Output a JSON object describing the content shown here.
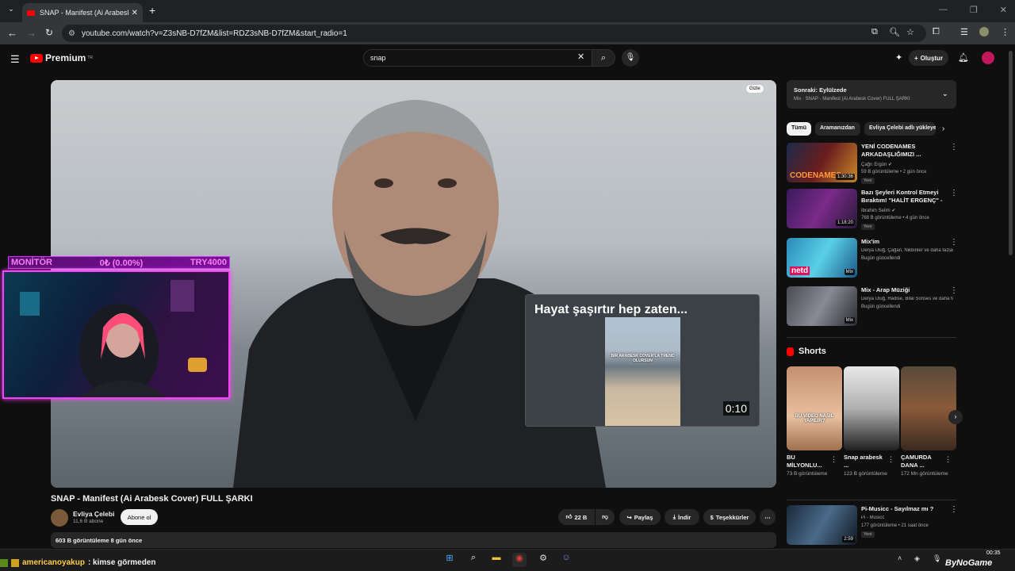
{
  "browser": {
    "tab_title": "SNAP - Manifest (Ai Arabesk Co",
    "new_tab": "+",
    "url": "youtube.com/watch?v=Z3sNB-D7fZM&list=RDZ3sNB-D7fZM&start_radio=1"
  },
  "youtube": {
    "logo": "Premium",
    "region": "TR",
    "search_value": "snap",
    "create_label": "Oluştur"
  },
  "video": {
    "hide_label": "Gizle",
    "preview_title": "Hayat şaşırtır hep zaten...",
    "preview_caption": "BİR ARABESK COVER'LA TREND OLURSUN",
    "preview_duration": "0:10",
    "title": "SNAP - Manifest (Ai Arabesk Cover) FULL ŞARKI",
    "channel": "Evliya Çelebi",
    "subscribers": "11,6 B abone",
    "subscribe": "Abone ol",
    "likes": "22 B",
    "share": "Paylaş",
    "download": "İndir",
    "thanks": "Teşekkürler",
    "description": "603 B görüntüleme  8 gün önce"
  },
  "overlay": {
    "monitor": "MONİTÖR",
    "amount": "0₺ (0.00%)",
    "goal": "TRY4000"
  },
  "sidebar": {
    "upnext_title": "Sonraki: Eylülzede",
    "upnext_sub": "Mix · SNAP - Manifest (Ai Arabesk Cover) FULL ŞARKI",
    "chips": [
      "Tümü",
      "Aramanızdan",
      "Evliya Çelebi adlı yükleyen"
    ],
    "recs": [
      {
        "title": "YENİ CODENAMES ARKADAŞLIĞIMIZI ...",
        "channel": "Çağrı Ergün ✔",
        "meta": "59 B görüntüleme • 2 gün önce",
        "badge": "Yeni",
        "duration": "1:30:36",
        "thumb_text": "CODENAMES"
      },
      {
        "title": "Bazı Şeyleri Kontrol Etmeyi Bıraktım! \"HALİT ERGENÇ\" - ...",
        "channel": "İbrahim Selim ✔",
        "meta": "768 B görüntüleme • 4 gün önce",
        "badge": "Yeni",
        "duration": "1:18:20",
        "thumb_text": ""
      },
      {
        "title": "Mix'im",
        "channel": "Derya Uluğ, Çağan, Nikbinler ve daha fazlası",
        "meta": "Bugün güncellendi",
        "badge": "",
        "duration": "Mix",
        "thumb_text": "netd"
      },
      {
        "title": "Mix - Arap Müziği",
        "channel": "Derya Uluğ, Hadise, Bilal Sonses ve daha fazlası",
        "meta": "Bugün güncellendi",
        "badge": "",
        "duration": "Mix",
        "thumb_text": ""
      }
    ],
    "shorts_label": "Shorts",
    "shorts": [
      {
        "title": "BU MİLYONLU...",
        "views": "73 B görüntüleme",
        "thumb_text": "BU VİDEO NASIL YAPILIR?"
      },
      {
        "title": "Snap arabesk ...",
        "views": "123 B görüntüleme",
        "thumb_text": ""
      },
      {
        "title": "ÇAMURDA DANA ...",
        "views": "172 Mn görüntüleme",
        "thumb_text": ""
      }
    ],
    "bottom_rec": {
      "title": "Pi-Musicc - Sayılmaz mı ?",
      "channel": "Pi - Musicc",
      "meta": "177 görüntüleme • 21 saat önce",
      "badge": "Yeni",
      "duration": "2:59"
    }
  },
  "chat": {
    "user": "americanoyakup",
    "message": ": kimse görmeden"
  },
  "taskbar": {
    "time": "00:35",
    "watermark": "ByNoGame"
  },
  "colors": {
    "accent": "#ff0000",
    "overlay": "#ff40ff",
    "bg": "#0f0f0f"
  }
}
